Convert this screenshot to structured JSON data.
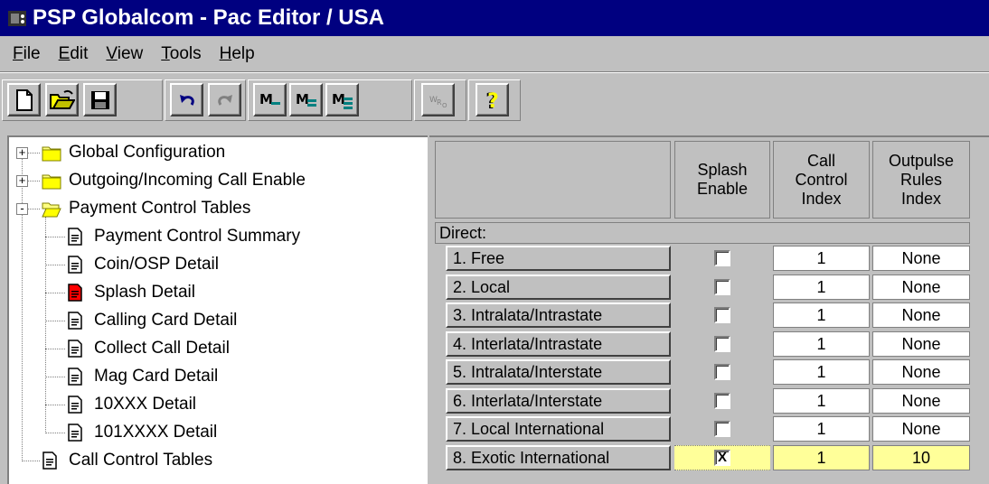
{
  "window": {
    "title": "PSP Globalcom - Pac Editor / USA",
    "icon": "phone-icon"
  },
  "menu": {
    "items": [
      {
        "key": "F",
        "rest": "ile"
      },
      {
        "key": "E",
        "rest": "dit"
      },
      {
        "key": "V",
        "rest": "iew"
      },
      {
        "key": "T",
        "rest": "ools"
      },
      {
        "key": "H",
        "rest": "elp"
      }
    ]
  },
  "toolbar": {
    "buttons": [
      "new-document-icon",
      "open-folder-icon",
      "save-disk-icon",
      "undo-icon",
      "redo-icon",
      "macro-1-icon",
      "macro-2-icon",
      "macro-3-icon",
      "wro-icon",
      "help-question-icon"
    ]
  },
  "tree": {
    "items": [
      {
        "label": "Global Configuration",
        "level": 0,
        "icon": "folder-icon",
        "expander": "+"
      },
      {
        "label": "Outgoing/Incoming Call Enable",
        "level": 0,
        "icon": "folder-icon",
        "expander": "+"
      },
      {
        "label": "Payment Control Tables",
        "level": 0,
        "icon": "folder-open-icon",
        "expander": "-"
      },
      {
        "label": "Payment Control Summary",
        "level": 1,
        "icon": "document-icon"
      },
      {
        "label": "Coin/OSP Detail",
        "level": 1,
        "icon": "document-icon"
      },
      {
        "label": "Splash Detail",
        "level": 1,
        "icon": "document-red-icon",
        "selected": true
      },
      {
        "label": "Calling Card Detail",
        "level": 1,
        "icon": "document-icon"
      },
      {
        "label": "Collect Call Detail",
        "level": 1,
        "icon": "document-icon"
      },
      {
        "label": "Mag Card Detail",
        "level": 1,
        "icon": "document-icon"
      },
      {
        "label": "10XXX Detail",
        "level": 1,
        "icon": "document-icon"
      },
      {
        "label": "101XXXX Detail",
        "level": 1,
        "icon": "document-icon"
      },
      {
        "label": "Call Control Tables",
        "level": 0,
        "icon": "document-icon"
      }
    ]
  },
  "grid": {
    "headers": {
      "splash": "Splash\nEnable",
      "call_control": "Call\nControl\nIndex",
      "outpulse": "Outpulse\nRules\nIndex"
    },
    "section": "Direct:",
    "rows": [
      {
        "label": "1.  Free",
        "splash": false,
        "call_control": "1",
        "outpulse": "None"
      },
      {
        "label": "2.  Local",
        "splash": false,
        "call_control": "1",
        "outpulse": "None"
      },
      {
        "label": "3.  Intralata/Intrastate",
        "splash": false,
        "call_control": "1",
        "outpulse": "None"
      },
      {
        "label": "4.  Interlata/Intrastate",
        "splash": false,
        "call_control": "1",
        "outpulse": "None"
      },
      {
        "label": "5.  Intralata/Interstate",
        "splash": false,
        "call_control": "1",
        "outpulse": "None"
      },
      {
        "label": "6.  Interlata/Interstate",
        "splash": false,
        "call_control": "1",
        "outpulse": "None"
      },
      {
        "label": "7.  Local International",
        "splash": false,
        "call_control": "1",
        "outpulse": "None"
      },
      {
        "label": "8.  Exotic International",
        "splash": true,
        "call_control": "1",
        "outpulse": "10",
        "selected": true
      }
    ],
    "checked_mark": "X"
  },
  "colors": {
    "title_bar": "#000080",
    "face": "#c0c0c0",
    "selection": "#ffff99"
  }
}
